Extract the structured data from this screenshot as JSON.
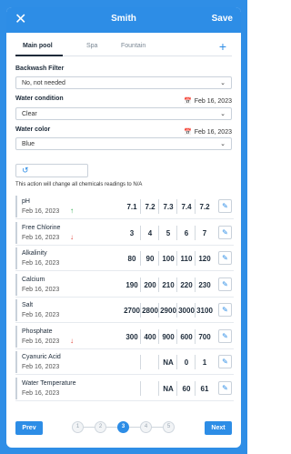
{
  "header": {
    "close_label": "✕",
    "title": "Smith",
    "save_label": "Save"
  },
  "tabs": [
    {
      "label": "Main pool",
      "active": true
    },
    {
      "label": "Spa",
      "active": false
    },
    {
      "label": "Fountain",
      "active": false
    }
  ],
  "tab_add_label": "+",
  "backwash": {
    "label": "Backwash Filter",
    "value": "No, not needed"
  },
  "water_condition": {
    "label": "Water condition",
    "date": "Feb 16, 2023",
    "value": "Clear"
  },
  "water_color": {
    "label": "Water color",
    "date": "Feb 16, 2023",
    "value": "Blue"
  },
  "notice": "This action will change all chemicals readings to N/A",
  "readings": [
    {
      "name": "pH",
      "date": "Feb 16, 2023",
      "trend": "up",
      "values": [
        "7.1",
        "7.2",
        "7.3",
        "7.4",
        "7.2"
      ]
    },
    {
      "name": "Free Chlorine",
      "date": "Feb 16, 2023",
      "trend": "down",
      "values": [
        "3",
        "4",
        "5",
        "6",
        "7"
      ]
    },
    {
      "name": "Alkalinity",
      "date": "Feb 16, 2023",
      "trend": "",
      "values": [
        "80",
        "90",
        "100",
        "110",
        "120"
      ]
    },
    {
      "name": "Calcium",
      "date": "Feb 16, 2023",
      "trend": "",
      "values": [
        "190",
        "200",
        "210",
        "220",
        "230"
      ]
    },
    {
      "name": "Salt",
      "date": "Feb 16, 2023",
      "trend": "",
      "values": [
        "2700",
        "2800",
        "2900",
        "3000",
        "3100"
      ]
    },
    {
      "name": "Phosphate",
      "date": "Feb 16, 2023",
      "trend": "down",
      "values": [
        "300",
        "400",
        "900",
        "600",
        "700"
      ]
    },
    {
      "name": "Cyanuric Acid",
      "date": "Feb 16, 2023",
      "trend": "",
      "values": [
        "",
        "",
        "NA",
        "0",
        "1"
      ]
    },
    {
      "name": "Water Temperature",
      "date": "Feb 16, 2023",
      "trend": "",
      "values": [
        "",
        "",
        "NA",
        "60",
        "61"
      ]
    }
  ],
  "footer": {
    "prev_label": "Prev",
    "next_label": "Next",
    "steps": [
      "1",
      "2",
      "3",
      "4",
      "5"
    ],
    "active_step": 3
  },
  "icons": {
    "close": "close-icon",
    "add": "plus-icon",
    "calendar": "calendar-icon",
    "chevron": "chevron-down-icon",
    "history": "history-icon",
    "edit": "pencil-icon",
    "trend_up": "arrow-up-icon",
    "trend_down": "arrow-down-icon"
  },
  "colors": {
    "accent": "#2d8de6",
    "trend_up": "#2aa84a",
    "trend_down": "#e0433a"
  }
}
